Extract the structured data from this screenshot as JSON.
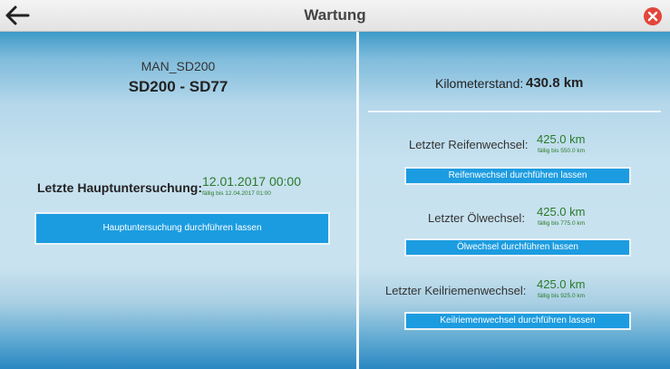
{
  "window": {
    "title": "Wartung"
  },
  "left": {
    "vehicle_id": "MAN_SD200",
    "vehicle_name": "SD200 - SD77",
    "hu_label": "Letzte Hauptuntersuchung:",
    "hu_date": "12.01.2017 00:00",
    "hu_due": "fällig bis 12.04.2017 01:00",
    "hu_button": "Hauptuntersuchung durchführen lassen"
  },
  "right": {
    "km_label": "Kilometerstand:",
    "km_value": "430.8 km",
    "tire_label": "Letzter Reifenwechsel:",
    "tire_value": "425.0 km",
    "tire_due": "fällig bis 550.0 km",
    "tire_button": "Reifenwechsel durchführen lassen",
    "oil_label": "Letzter Ölwechsel:",
    "oil_value": "425.0 km",
    "oil_due": "fällig bis 775.0 km",
    "oil_button": "Ölwechsel durchführen lassen",
    "belt_label": "Letzter Keilriemenwechsel:",
    "belt_value": "425.0 km",
    "belt_due": "fällig bis 925.0 km",
    "belt_button": "Keilriemenwechsel durchführen lassen"
  },
  "icons": {
    "back": "arrow-left-icon",
    "close": "close-icon"
  },
  "colors": {
    "accent": "#1c9ce0",
    "close": "#e2463b",
    "due": "#2a7a2a"
  }
}
